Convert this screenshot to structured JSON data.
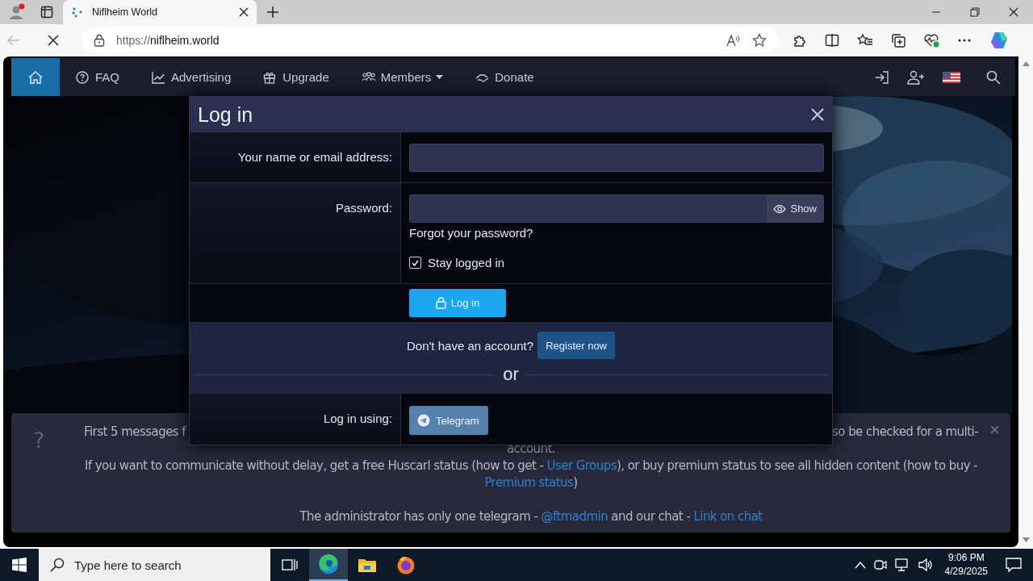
{
  "browser": {
    "tab": {
      "title": "Niflheim World"
    },
    "address": {
      "scheme": "https://",
      "host": "niflheim.world"
    }
  },
  "site_nav": {
    "items": [
      {
        "kind": "home",
        "selected": true,
        "dropdown": false
      },
      {
        "kind": "faq",
        "label": "FAQ",
        "selected": false,
        "dropdown": false
      },
      {
        "kind": "chart",
        "label": "Advertising",
        "selected": false,
        "dropdown": false
      },
      {
        "kind": "gift",
        "label": "Upgrade",
        "selected": false,
        "dropdown": false
      },
      {
        "kind": "users",
        "label": "Members",
        "selected": false,
        "dropdown": true
      },
      {
        "kind": "hand",
        "label": "Donate",
        "selected": false,
        "dropdown": false
      }
    ]
  },
  "modal": {
    "title": "Log in",
    "name_label": "Your name or email address:",
    "password_label": "Password:",
    "show_button": "Show",
    "forgot_link": "Forgot your password?",
    "stay_logged_in": {
      "label": "Stay logged in",
      "checked": true
    },
    "login_button": "Log in",
    "register_prompt": "Don't have an account?",
    "register_button": "Register now",
    "divider_text": "or",
    "social_label": "Log in using:",
    "telegram_button": "Telegram"
  },
  "notice": {
    "icon": "?",
    "lines": [
      {
        "kind": "split",
        "left": "First 5 messages f",
        "right": "so be checked for a multi-"
      },
      {
        "kind": "flow",
        "segments": [
          {
            "kind": "text",
            "text": "account."
          }
        ]
      },
      {
        "kind": "flow",
        "segments": [
          {
            "kind": "text",
            "text": "If you want to communicate without delay, get a free Huscarl status (how to get - "
          },
          {
            "kind": "link",
            "text": "User Groups"
          },
          {
            "kind": "text",
            "text": "), or buy premium status to see all hidden content (how to buy -"
          }
        ]
      },
      {
        "kind": "flow",
        "segments": [
          {
            "kind": "link",
            "text": "Premium status"
          },
          {
            "kind": "text",
            "text": ")"
          }
        ]
      },
      {
        "kind": "gap"
      },
      {
        "kind": "flow",
        "segments": [
          {
            "kind": "text",
            "text": "The administrator has only one telegram - "
          },
          {
            "kind": "link",
            "text": "@ftmadmin"
          },
          {
            "kind": "text",
            "text": " and our chat - "
          },
          {
            "kind": "link",
            "text": "Link on chat"
          }
        ]
      }
    ]
  },
  "taskbar": {
    "search_placeholder": "Type here to search",
    "time": "9:06 PM",
    "date": "4/29/2025"
  }
}
